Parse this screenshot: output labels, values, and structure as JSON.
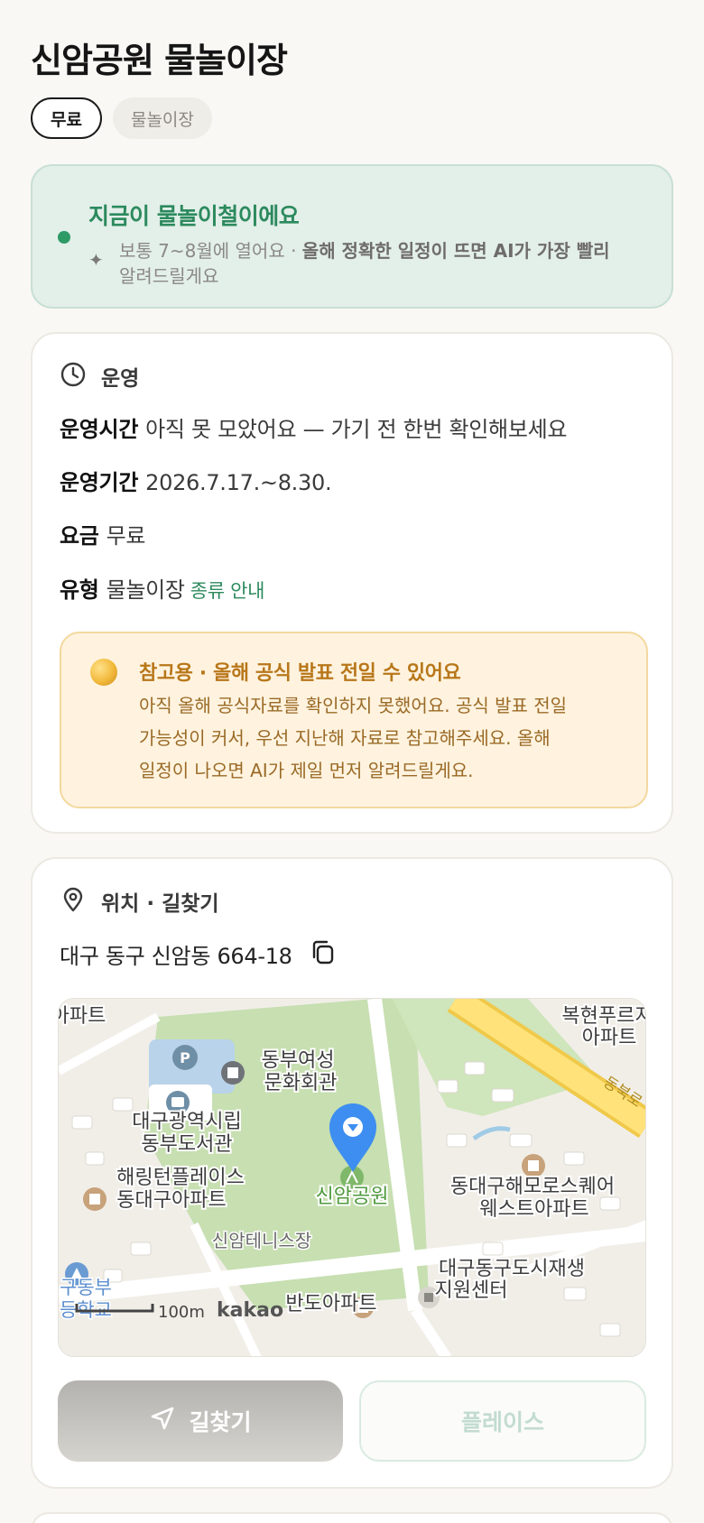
{
  "place": {
    "title": "신암공원 물놀이장",
    "chips": [
      "무료",
      "물놀이장"
    ]
  },
  "season": {
    "heading": "지금이 물놀이철이에요",
    "desc_plain": "보통 7~8월에 열어요 · ",
    "desc_bold": "올해 정확한 일정이 뜨면 AI가 가장 빨리",
    "desc_tail": "알려드릴게요",
    "icon": "sparkle-icon",
    "dot_color": "#2e9a66"
  },
  "operation": {
    "section_label": "운영",
    "section_icon": "clock-icon",
    "hours_key": "운영시간",
    "hours_val": "아직 못 모았어요 — 가기 전 한번 확인해보세요",
    "period_key": "운영기간",
    "period_val": "2026.7.17.~8.30.",
    "fee_key": "요금",
    "fee_val": "무료",
    "type_key": "유형",
    "type_val": "물놀이장",
    "type_link": "종류 안내"
  },
  "notice": {
    "title": "참고용 · 올해 공식 발표 전일 수 있어요",
    "line1": "아직 올해 공식자료를 확인하지 못했어요. 공식 발표 전일",
    "line2": "가능성이 커서, 우선 지난해 자료로 참고해주세요. 올해",
    "line3": "일정이 나오면 AI가 제일 먼저 알려드릴게요.",
    "icon": "moon-icon"
  },
  "location": {
    "section_label": "위치 · 길찾기",
    "section_icon": "location-pin-icon",
    "address": "대구 동구 신암동 664-18",
    "copy_icon": "copy-icon",
    "map": {
      "labels": {
        "park": "신암공원",
        "culture1": "동부여성",
        "culture2": "문화회관",
        "library1": "대구광역시립",
        "library2": "동부도서관",
        "apt_h1": "해링턴플레이스",
        "apt_h2": "동대구아파트",
        "tennis": "신암테니스장",
        "apt_e1": "동대구해모로스퀘어",
        "apt_e2": "웨스트아파트",
        "regen1": "대구동구도시재생",
        "regen2": "지원센터",
        "apt_n1": "복현푸르지",
        "apt_n2": "아파트",
        "apt_top": "아파트",
        "school1": "구동부",
        "school2": "등학교",
        "bando": "반도아파트",
        "road": "동북로",
        "scale": "100m",
        "brand": "kakao"
      }
    },
    "directions_label": "길찾기",
    "place_label": "플레이스"
  }
}
